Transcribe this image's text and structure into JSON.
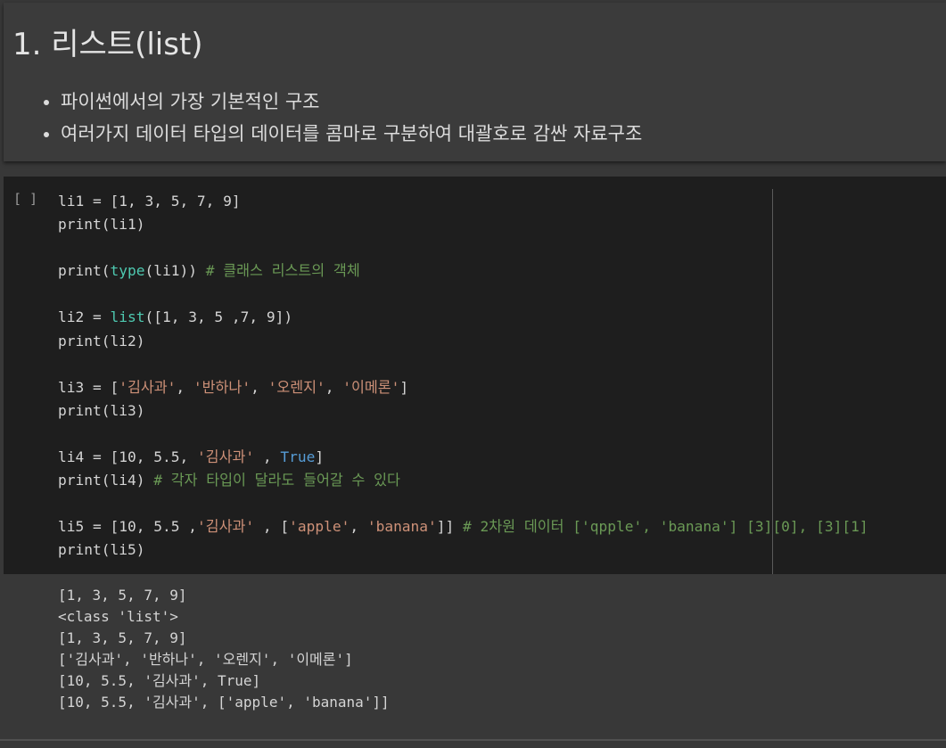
{
  "text_cell": {
    "heading": "1. 리스트(list)",
    "bullets": [
      "파이썬에서의 가장 기본적인 구조",
      "여러가지 데이터 타입의 데이터를 콤마로 구분하여 대괄호로 감싼 자료구조"
    ]
  },
  "code_cell": {
    "run_prompt": "[ ]",
    "lines": [
      [
        {
          "t": "li1 = [1, 3, 5, 7, 9]",
          "c": "plain"
        }
      ],
      [
        {
          "t": "print(li1)",
          "c": "plain"
        }
      ],
      [],
      [
        {
          "t": "print(",
          "c": "plain"
        },
        {
          "t": "type",
          "c": "builtin"
        },
        {
          "t": "(li1)) ",
          "c": "plain"
        },
        {
          "t": "# 클래스 리스트의 객체",
          "c": "comment"
        }
      ],
      [],
      [
        {
          "t": "li2 = ",
          "c": "plain"
        },
        {
          "t": "list",
          "c": "builtin"
        },
        {
          "t": "([1, 3, 5 ,7, 9])",
          "c": "plain"
        }
      ],
      [
        {
          "t": "print(li2)",
          "c": "plain"
        }
      ],
      [],
      [
        {
          "t": "li3 = [",
          "c": "plain"
        },
        {
          "t": "'김사과'",
          "c": "string"
        },
        {
          "t": ", ",
          "c": "plain"
        },
        {
          "t": "'반하나'",
          "c": "string"
        },
        {
          "t": ", ",
          "c": "plain"
        },
        {
          "t": "'오렌지'",
          "c": "string"
        },
        {
          "t": ", ",
          "c": "plain"
        },
        {
          "t": "'이메론'",
          "c": "string"
        },
        {
          "t": "]",
          "c": "plain"
        }
      ],
      [
        {
          "t": "print(li3)",
          "c": "plain"
        }
      ],
      [],
      [
        {
          "t": "li4 = [10, 5.5, ",
          "c": "plain"
        },
        {
          "t": "'김사과'",
          "c": "string"
        },
        {
          "t": " , ",
          "c": "plain"
        },
        {
          "t": "True",
          "c": "keyword"
        },
        {
          "t": "]",
          "c": "plain"
        }
      ],
      [
        {
          "t": "print(li4) ",
          "c": "plain"
        },
        {
          "t": "# 각자 타입이 달라도 들어갈 수 있다",
          "c": "comment"
        }
      ],
      [],
      [
        {
          "t": "li5 = [10, 5.5 ,",
          "c": "plain"
        },
        {
          "t": "'김사과'",
          "c": "string"
        },
        {
          "t": " , [",
          "c": "plain"
        },
        {
          "t": "'apple'",
          "c": "string"
        },
        {
          "t": ", ",
          "c": "plain"
        },
        {
          "t": "'banana'",
          "c": "string"
        },
        {
          "t": "]] ",
          "c": "plain"
        },
        {
          "t": "# 2차원 데이터 ['qpple', 'banana'] [3][0], [3][1]",
          "c": "comment"
        }
      ],
      [
        {
          "t": "print(li5)",
          "c": "plain"
        }
      ]
    ]
  },
  "output": {
    "lines": [
      "[1, 3, 5, 7, 9]",
      "<class 'list'>",
      "[1, 3, 5, 7, 9]",
      "['김사과', '반하나', '오렌지', '이메론']",
      "[10, 5.5, '김사과', True]",
      "[10, 5.5, '김사과', ['apple', 'banana']]"
    ]
  },
  "colors": {
    "page_bg": "#383838",
    "text_cell_bg": "#3b3b3b",
    "code_bg": "#1e1e1e",
    "plain": "#d4d4d4",
    "builtin": "#4ec9b0",
    "comment": "#6a9955",
    "string": "#ce9178",
    "keyword": "#569cd6"
  }
}
